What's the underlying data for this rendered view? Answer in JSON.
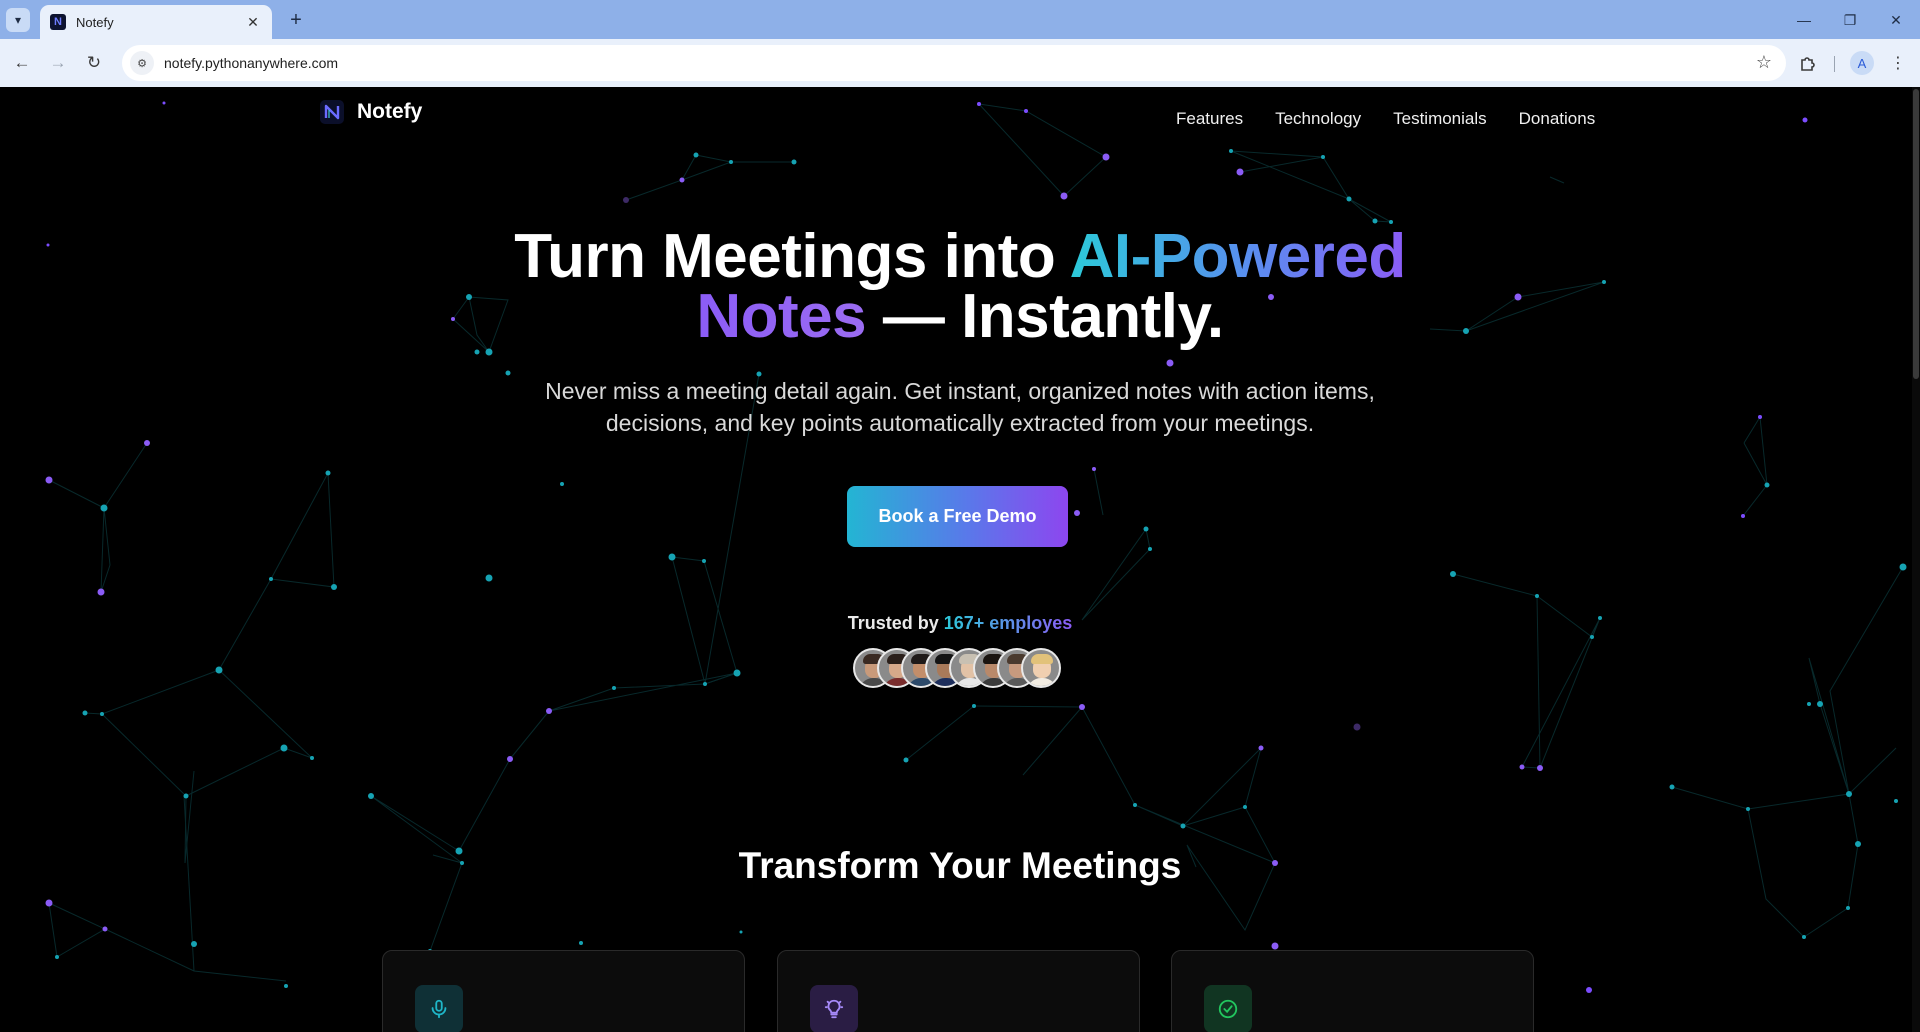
{
  "browser": {
    "tab_title": "Notefy",
    "tab_favicon_letter": "N",
    "url": "notefy.pythonanywhere.com",
    "profile_initial": "A"
  },
  "site": {
    "brand": "Notefy",
    "nav": [
      "Features",
      "Technology",
      "Testimonials",
      "Donations"
    ]
  },
  "hero": {
    "title_part1": "Turn Meetings into ",
    "title_highlight1": "AI-Powered",
    "title_highlight2": "Notes",
    "title_part2": " — Instantly.",
    "subtitle": "Never miss a meeting detail again. Get instant, organized notes with action items, decisions, and key points automatically extracted from your meetings.",
    "cta_label": "Book a Free Demo",
    "trusted_prefix": "Trusted by ",
    "trusted_count": "167+ employes"
  },
  "avatars": [
    {
      "skin": "#c99a7a",
      "hair": "#3a2a22",
      "shirt": "#4a4a4a"
    },
    {
      "skin": "#d6a98a",
      "hair": "#2a1f1a",
      "shirt": "#7a2d2d"
    },
    {
      "skin": "#c38e6a",
      "hair": "#1f1a18",
      "shirt": "#2d4a6a"
    },
    {
      "skin": "#a97a5a",
      "hair": "#141414",
      "shirt": "#1d2e5c"
    },
    {
      "skin": "#e2c2a6",
      "hair": "#c8c0b2",
      "shirt": "#e6e6e6"
    },
    {
      "skin": "#b9896a",
      "hair": "#1a1410",
      "shirt": "#3a3a3a"
    },
    {
      "skin": "#c79a7e",
      "hair": "#4a3a2e",
      "shirt": "#5a5a5a"
    },
    {
      "skin": "#f0cfb0",
      "hair": "#e2c27a",
      "shirt": "#f2ece2"
    }
  ],
  "features": {
    "title": "Transform Your Meetings",
    "cards": [
      {
        "icon": "microphone-icon",
        "accent": "#1fb6c8",
        "bg": "#0f3036"
      },
      {
        "icon": "lightbulb-icon",
        "accent": "#a78bfa",
        "bg": "#2a1d44"
      },
      {
        "icon": "check-circle-icon",
        "accent": "#22c55e",
        "bg": "#113522"
      }
    ]
  },
  "theme": {
    "accent_cyan": "#2cc9d8",
    "accent_purple": "#8b5cf6"
  }
}
